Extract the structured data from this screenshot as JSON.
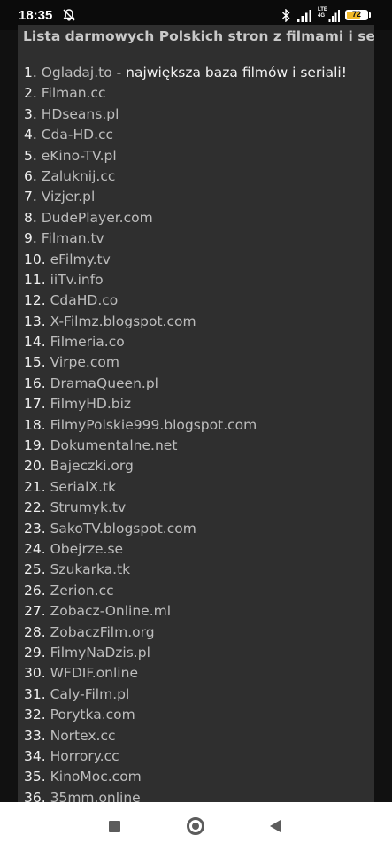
{
  "status_bar": {
    "time": "18:35",
    "lte_label_top": "LTE",
    "lte_label_bottom": "4G",
    "battery_level": "72",
    "battery_fraction": 0.72,
    "battery_color": "#f2b928",
    "icons": [
      "notifications-muted-icon",
      "bluetooth-icon",
      "signal-icon",
      "lte-icon",
      "signal-icon",
      "battery-icon"
    ]
  },
  "page": {
    "title": "Lista darmowych Polskich stron z filmami i serialami:",
    "items": [
      {
        "num": "1.",
        "site": "Ogladaj.to",
        "desc": " - największa baza filmów i seriali!"
      },
      {
        "num": "2.",
        "site": "Filman.cc"
      },
      {
        "num": "3.",
        "site": "HDseans.pl"
      },
      {
        "num": "4.",
        "site": "Cda-HD.cc"
      },
      {
        "num": "5.",
        "site": "eKino-TV.pl"
      },
      {
        "num": "6.",
        "site": "Zaluknij.cc"
      },
      {
        "num": "7.",
        "site": "Vizjer.pl"
      },
      {
        "num": "8.",
        "site": "DudePlayer.com"
      },
      {
        "num": "9.",
        "site": "Filman.tv"
      },
      {
        "num": "10.",
        "site": "eFilmy.tv"
      },
      {
        "num": "11.",
        "site": "iiTv.info"
      },
      {
        "num": "12.",
        "site": "CdaHD.co"
      },
      {
        "num": "13.",
        "site": "X-Filmz.blogspot.com"
      },
      {
        "num": "14.",
        "site": "Filmeria.co"
      },
      {
        "num": "15.",
        "site": "Virpe.com"
      },
      {
        "num": "16.",
        "site": "DramaQueen.pl"
      },
      {
        "num": "17.",
        "site": "FilmyHD.biz"
      },
      {
        "num": "18.",
        "site": "FilmyPolskie999.blogspot.com"
      },
      {
        "num": "19.",
        "site": "Dokumentalne.net"
      },
      {
        "num": "20.",
        "site": "Bajeczki.org"
      },
      {
        "num": "21.",
        "site": "SerialX.tk"
      },
      {
        "num": "22.",
        "site": "Strumyk.tv"
      },
      {
        "num": "23.",
        "site": "SakoTV.blogspot.com"
      },
      {
        "num": "24.",
        "site": "Obejrze.se"
      },
      {
        "num": "25.",
        "site": "Szukarka.tk"
      },
      {
        "num": "26.",
        "site": "Zerion.cc"
      },
      {
        "num": "27.",
        "site": "Zobacz-Online.ml"
      },
      {
        "num": "28.",
        "site": "ZobaczFilm.org"
      },
      {
        "num": "29.",
        "site": "FilmyNaDzis.pl"
      },
      {
        "num": "30.",
        "site": "WFDIF.online"
      },
      {
        "num": "31.",
        "site": "Caly-Film.pl"
      },
      {
        "num": "32.",
        "site": "Porytka.com"
      },
      {
        "num": "33.",
        "site": "Nortex.cc"
      },
      {
        "num": "34.",
        "site": "Horrory.cc"
      },
      {
        "num": "35.",
        "site": "KinoMoc.com"
      },
      {
        "num": "36.",
        "site": "35mm.online"
      }
    ]
  },
  "nav_bar": {
    "icons": [
      "recent-apps-icon",
      "home-icon",
      "back-icon"
    ]
  },
  "colors": {
    "page_background": "#2f2f2f",
    "outer_background": "#111111",
    "link_text": "#bdbdbd",
    "body_text": "#f2f2f2",
    "nav_background": "#ffffff",
    "nav_icon": "#5c5c5c"
  }
}
